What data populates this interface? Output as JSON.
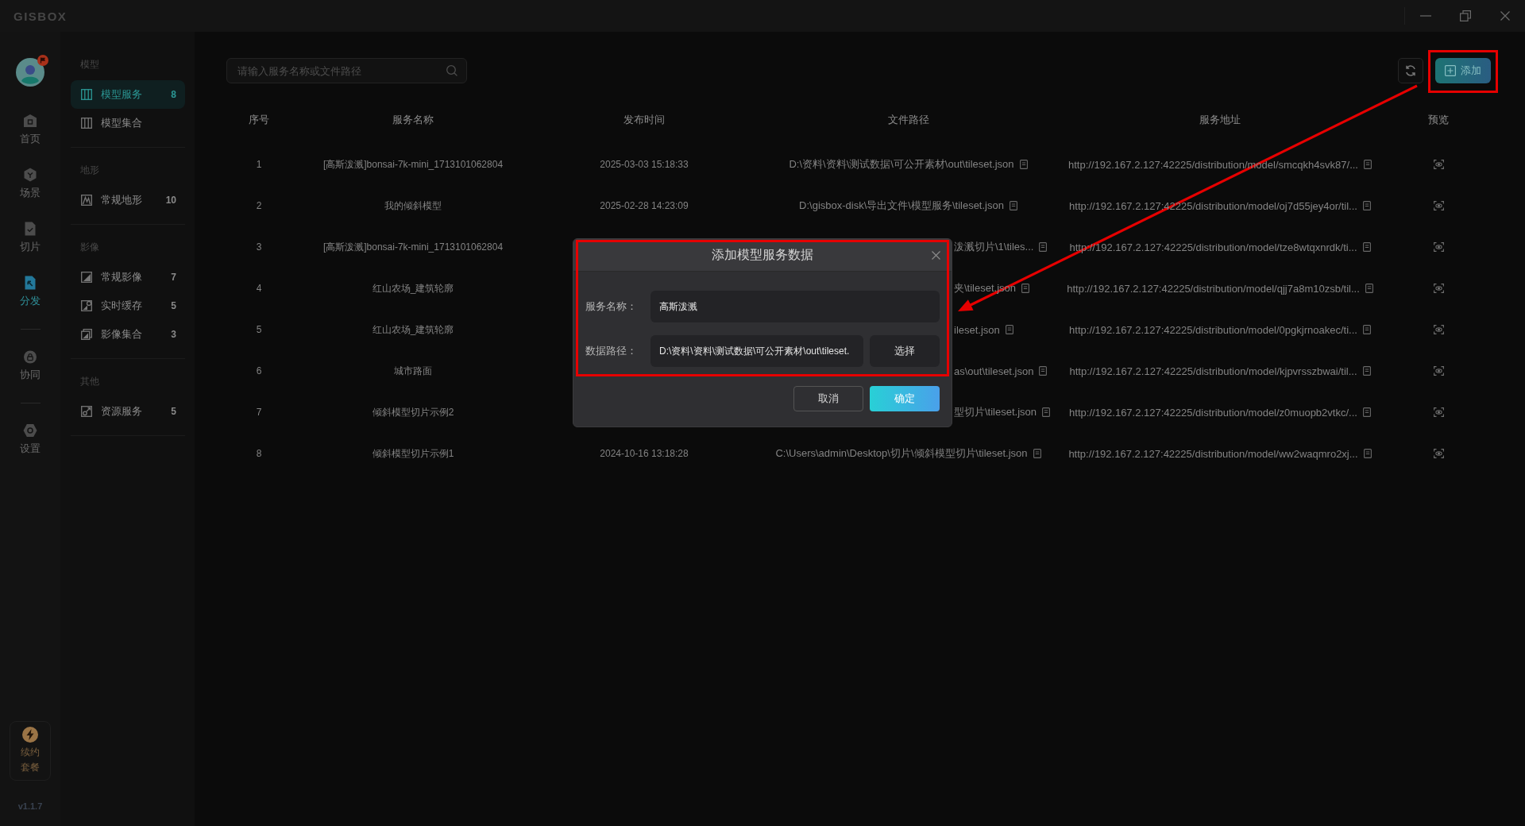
{
  "window": {
    "logo": "GISBOX"
  },
  "rail_groups": [
    {
      "items": [
        {
          "kind": "home",
          "label": "首页",
          "selected": false
        },
        {
          "kind": "scene",
          "label": "场景",
          "selected": false
        },
        {
          "kind": "slice",
          "label": "切片",
          "selected": false
        },
        {
          "kind": "distribute",
          "label": "分发",
          "selected": true
        }
      ]
    },
    {
      "items": [
        {
          "kind": "collab",
          "label": "协同",
          "selected": false
        }
      ]
    },
    {
      "items": [
        {
          "kind": "settings",
          "label": "设置",
          "selected": false
        }
      ]
    }
  ],
  "renew_plan": {
    "label": "续约套餐"
  },
  "version": "v1.1.7",
  "nav_sections": [
    {
      "title": "模型",
      "items": [
        {
          "kind": "model",
          "label": "模型服务",
          "count": "8",
          "selected": true
        },
        {
          "kind": "model",
          "label": "模型集合",
          "selected": false
        }
      ]
    },
    {
      "title": "地形",
      "items": [
        {
          "kind": "terrain",
          "label": "常规地形",
          "count": "10",
          "selected": false
        }
      ]
    },
    {
      "title": "影像",
      "items": [
        {
          "kind": "imagery",
          "label": "常规影像",
          "count": "7",
          "selected": false
        },
        {
          "kind": "cache",
          "label": "实时缓存",
          "count": "5",
          "selected": false
        },
        {
          "kind": "imageset",
          "label": "影像集合",
          "count": "3",
          "selected": false
        }
      ]
    },
    {
      "title": "其他",
      "items": [
        {
          "kind": "resource",
          "label": "资源服务",
          "count": "5",
          "selected": false
        }
      ]
    }
  ],
  "search": {
    "placeholder": "请输入服务名称或文件路径"
  },
  "add_button": {
    "label": "添加"
  },
  "table": {
    "columns": [
      "序号",
      "服务名称",
      "发布时间",
      "文件路径",
      "服务地址",
      "预览"
    ],
    "rows": [
      {
        "kind": "full",
        "index": "1",
        "name": "[高斯泼溅]bonsai-7k-mini_1713101062804",
        "published": "2025-03-03 15:18:33",
        "file_path": "D:\\资料\\资料\\测试数据\\可公开素材\\out\\tileset.json",
        "service_url": "http://192.167.2.127:42225/distribution/model/smcqkh4svk87/..."
      },
      {
        "kind": "full",
        "index": "2",
        "name": "我的倾斜模型",
        "published": "2025-02-28 14:23:09",
        "file_path": "D:\\gisbox-disk\\导出文件\\模型服务\\tileset.json",
        "service_url": "http://192.167.2.127:42225/distribution/model/oj7d55jey4or/til..."
      },
      {
        "kind": "covered",
        "index": "3",
        "name": "[高斯泼溅]bonsai-7k-mini_1713101062804",
        "file_path": "泼溅切片\\1\\tiles...",
        "service_url": "http://192.167.2.127:42225/distribution/model/tze8wtqxnrdk/ti..."
      },
      {
        "kind": "covered",
        "index": "4",
        "name": "红山农场_建筑轮廓",
        "file_path": "夹\\tileset.json",
        "service_url": "http://192.167.2.127:42225/distribution/model/qjj7a8m10zsb/til..."
      },
      {
        "kind": "covered",
        "index": "5",
        "name": "红山农场_建筑轮廓",
        "file_path": "ileset.json",
        "service_url": "http://192.167.2.127:42225/distribution/model/0pgkjrnoakec/ti..."
      },
      {
        "kind": "covered",
        "index": "6",
        "name": "城市路面",
        "file_path": "as\\out\\tileset.json",
        "service_url": "http://192.167.2.127:42225/distribution/model/kjpvrsszbwai/til..."
      },
      {
        "kind": "covered",
        "index": "7",
        "name": "倾斜模型切片示例2",
        "file_path": "型切片\\tileset.json",
        "service_url": "http://192.167.2.127:42225/distribution/model/z0muopb2vtkc/..."
      },
      {
        "kind": "full",
        "index": "8",
        "name": "倾斜模型切片示例1",
        "published": "2024-10-16 13:18:28",
        "file_path": "C:\\Users\\admin\\Desktop\\切片\\倾斜模型切片\\tileset.json",
        "service_url": "http://192.167.2.127:42225/distribution/model/ww2waqmro2xj..."
      }
    ]
  },
  "dialog": {
    "title": "添加模型服务数据",
    "fields": [
      {
        "label": "服务名称：",
        "value": "高斯泼溅"
      },
      {
        "label": "数据路径：",
        "value": "D:\\资料\\资料\\测试数据\\可公开素材\\out\\tileset.",
        "button": "选择"
      }
    ],
    "buttons": [
      {
        "kind": "cancel",
        "label": "取消"
      },
      {
        "kind": "confirm",
        "label": "确定"
      }
    ]
  }
}
